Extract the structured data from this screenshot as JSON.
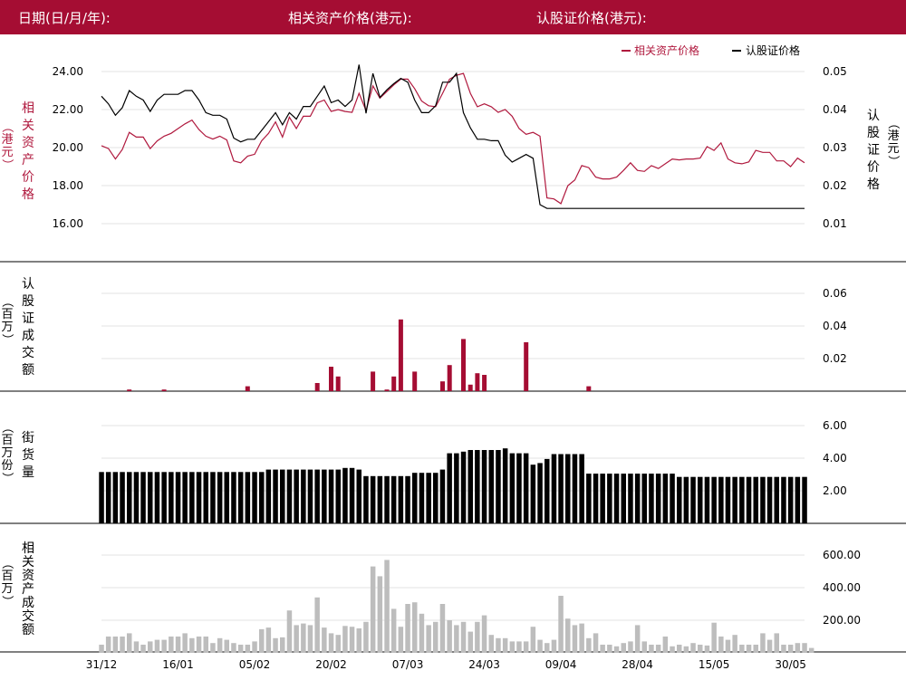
{
  "header": {
    "date_label": "日期(日/月/年):",
    "asset_price_label": "相关资产价格(港元):",
    "warrant_price_label": "认股证价格(港元):"
  },
  "colors": {
    "brand": "#a50d33",
    "asset_line": "#b0193e",
    "warrant_line": "#000000",
    "warrant_turnover_bar": "#a50d33",
    "outstanding_bar": "#000000",
    "asset_turnover_bar": "#bdbdbd"
  },
  "chart_data": [
    {
      "type": "line",
      "legend_position": "top-right",
      "legend": [
        "相关资产价格",
        "认股证价格"
      ],
      "left_axis_label": [
        "相",
        "关",
        "资",
        "产",
        "价",
        "格",
        "（港元）"
      ],
      "right_axis_label": [
        "认",
        "股",
        "证",
        "价",
        "格",
        "（港元）"
      ],
      "y_left_ticks": [
        "24.00",
        "22.00",
        "20.00",
        "18.00",
        "16.00"
      ],
      "y_left_range": [
        15.5,
        24.6
      ],
      "y_right_ticks": [
        "0.05",
        "0.04",
        "0.03",
        "0.02",
        "0.01"
      ],
      "y_right_range": [
        0.0087,
        0.0518
      ],
      "series": [
        {
          "name": "相关资产价格",
          "axis": "left",
          "values": [
            20.1,
            19.95,
            19.4,
            19.9,
            20.8,
            20.55,
            20.55,
            19.95,
            20.35,
            20.6,
            20.75,
            21.0,
            21.25,
            21.45,
            20.95,
            20.6,
            20.45,
            20.6,
            20.4,
            19.3,
            19.2,
            19.55,
            19.65,
            20.35,
            20.75,
            21.35,
            20.55,
            21.6,
            21.0,
            21.65,
            21.65,
            22.35,
            22.5,
            21.9,
            22.0,
            21.9,
            21.85,
            22.85,
            21.95,
            23.25,
            22.6,
            22.95,
            23.3,
            23.6,
            23.6,
            23.1,
            22.45,
            22.2,
            22.15,
            22.85,
            23.6,
            23.8,
            23.9,
            22.85,
            22.15,
            22.3,
            22.15,
            21.85,
            22.0,
            21.65,
            21.0,
            20.7,
            20.8,
            20.6,
            17.35,
            17.3,
            17.05,
            18.0,
            18.3,
            19.05,
            18.95,
            18.45,
            18.35,
            18.35,
            18.45,
            18.8,
            19.2,
            18.8,
            18.75,
            19.05,
            18.9,
            19.15,
            19.4,
            19.35,
            19.4,
            19.4,
            19.45,
            20.05,
            19.85,
            20.25,
            19.4,
            19.2,
            19.15,
            19.25,
            19.85,
            19.75,
            19.75,
            19.3,
            19.3,
            19.0,
            19.45,
            19.2
          ]
        },
        {
          "name": "认股证价格",
          "axis": "right",
          "values": [
            0.0435,
            0.0415,
            0.0385,
            0.0405,
            0.045,
            0.0435,
            0.0425,
            0.0395,
            0.0425,
            0.044,
            0.044,
            0.044,
            0.045,
            0.045,
            0.0425,
            0.0392,
            0.0385,
            0.0385,
            0.0375,
            0.0325,
            0.0315,
            0.0322,
            0.0322,
            0.0345,
            0.0368,
            0.0392,
            0.036,
            0.0392,
            0.0375,
            0.0408,
            0.0408,
            0.0435,
            0.0462,
            0.0418,
            0.0425,
            0.0408,
            0.0425,
            0.0518,
            0.039,
            0.0495,
            0.0432,
            0.0452,
            0.0468,
            0.0482,
            0.0472,
            0.0425,
            0.0392,
            0.0392,
            0.041,
            0.0472,
            0.0472,
            0.0495,
            0.0392,
            0.0352,
            0.0322,
            0.0322,
            0.0318,
            0.0318,
            0.028,
            0.0262,
            0.0272,
            0.0282,
            0.0272,
            0.015,
            0.014,
            0.014,
            0.014,
            0.014,
            0.014,
            0.014,
            0.014,
            0.014,
            0.014,
            0.014,
            0.014,
            0.014,
            0.014,
            0.014,
            0.014,
            0.014,
            0.014,
            0.014,
            0.014,
            0.014,
            0.014,
            0.014,
            0.014,
            0.014,
            0.014,
            0.014,
            0.014,
            0.014,
            0.014,
            0.014,
            0.014,
            0.014,
            0.014,
            0.014,
            0.014,
            0.014,
            0.014,
            0.014
          ]
        }
      ]
    },
    {
      "type": "bar",
      "axis_label": [
        "认",
        "股",
        "证",
        "成",
        "交",
        "额"
      ],
      "axis_label_paren": "（百万）",
      "y_ticks": [
        "0.06",
        "0.04",
        "0.02"
      ],
      "y_range": [
        0,
        0.0605
      ],
      "values": [
        0,
        0,
        0,
        0,
        0.001,
        0,
        0,
        0,
        0,
        0.001,
        0,
        0,
        0,
        0,
        0,
        0,
        0,
        0,
        0,
        0,
        0,
        0.003,
        0,
        0,
        0,
        0,
        0,
        0,
        0,
        0,
        0,
        0.005,
        0,
        0.015,
        0.009,
        0,
        0,
        0,
        0,
        0.012,
        0,
        0.001,
        0.009,
        0.044,
        0,
        0.012,
        0,
        0,
        0,
        0.006,
        0.016,
        0,
        0.032,
        0.004,
        0.011,
        0.01,
        0,
        0,
        0,
        0,
        0,
        0.03,
        0,
        0,
        0,
        0,
        0,
        0,
        0,
        0,
        0.003,
        0,
        0,
        0,
        0,
        0,
        0,
        0,
        0,
        0,
        0,
        0,
        0,
        0,
        0,
        0,
        0,
        0,
        0,
        0,
        0,
        0,
        0,
        0,
        0,
        0,
        0,
        0,
        0,
        0,
        0,
        0
      ]
    },
    {
      "type": "bar",
      "axis_label": [
        "街",
        "货",
        "量"
      ],
      "axis_label_paren": "（百万份）",
      "y_ticks": [
        "6.00",
        "4.00",
        "2.00"
      ],
      "y_range": [
        0,
        6.0
      ],
      "values": [
        3.15,
        3.15,
        3.15,
        3.15,
        3.15,
        3.15,
        3.15,
        3.15,
        3.15,
        3.15,
        3.15,
        3.15,
        3.15,
        3.15,
        3.15,
        3.15,
        3.15,
        3.15,
        3.15,
        3.15,
        3.15,
        3.15,
        3.15,
        3.15,
        3.3,
        3.3,
        3.3,
        3.3,
        3.3,
        3.3,
        3.3,
        3.3,
        3.3,
        3.3,
        3.3,
        3.4,
        3.4,
        3.3,
        2.9,
        2.9,
        2.9,
        2.9,
        2.9,
        2.9,
        2.9,
        3.1,
        3.1,
        3.1,
        3.1,
        3.3,
        4.3,
        4.3,
        4.4,
        4.5,
        4.5,
        4.5,
        4.5,
        4.5,
        4.6,
        4.3,
        4.3,
        4.3,
        3.6,
        3.7,
        3.95,
        4.25,
        4.25,
        4.25,
        4.25,
        4.25,
        3.05,
        3.05,
        3.05,
        3.05,
        3.05,
        3.05,
        3.05,
        3.05,
        3.05,
        3.05,
        3.05,
        3.05,
        3.05,
        2.85,
        2.85,
        2.85,
        2.85,
        2.85,
        2.85,
        2.85,
        2.85,
        2.85,
        2.85,
        2.85,
        2.85,
        2.85,
        2.85,
        2.85,
        2.85,
        2.85,
        2.85,
        2.85
      ]
    },
    {
      "type": "bar",
      "axis_label": [
        "相",
        "关",
        "资",
        "产",
        "成",
        "交",
        "额"
      ],
      "axis_label_paren": "（百万）",
      "y_ticks": [
        "600.00",
        "400.00",
        "200.00"
      ],
      "y_range": [
        0,
        600
      ],
      "values": [
        50,
        100,
        100,
        100,
        120,
        70,
        50,
        70,
        80,
        80,
        100,
        100,
        120,
        90,
        100,
        100,
        60,
        90,
        80,
        60,
        50,
        50,
        70,
        145,
        155,
        90,
        95,
        260,
        170,
        180,
        170,
        340,
        155,
        120,
        110,
        165,
        160,
        150,
        190,
        530,
        470,
        570,
        270,
        160,
        300,
        310,
        240,
        170,
        190,
        300,
        200,
        170,
        190,
        130,
        190,
        230,
        110,
        90,
        90,
        70,
        70,
        70,
        160,
        80,
        60,
        80,
        350,
        210,
        170,
        180,
        90,
        120,
        50,
        50,
        40,
        60,
        70,
        170,
        70,
        50,
        50,
        100,
        40,
        50,
        40,
        60,
        50,
        45,
        185,
        100,
        80,
        110,
        50,
        50,
        50,
        120,
        80,
        120,
        50,
        50,
        60,
        60,
        30
      ]
    }
  ],
  "x_axis": {
    "ticks": [
      {
        "label": "31/12",
        "index": 0
      },
      {
        "label": "16/01",
        "index": 11
      },
      {
        "label": "05/02",
        "index": 22
      },
      {
        "label": "20/02",
        "index": 33
      },
      {
        "label": "07/03",
        "index": 44
      },
      {
        "label": "24/03",
        "index": 55
      },
      {
        "label": "09/04",
        "index": 66
      },
      {
        "label": "28/04",
        "index": 77
      },
      {
        "label": "15/05",
        "index": 88
      },
      {
        "label": "30/05",
        "index": 99
      }
    ]
  }
}
